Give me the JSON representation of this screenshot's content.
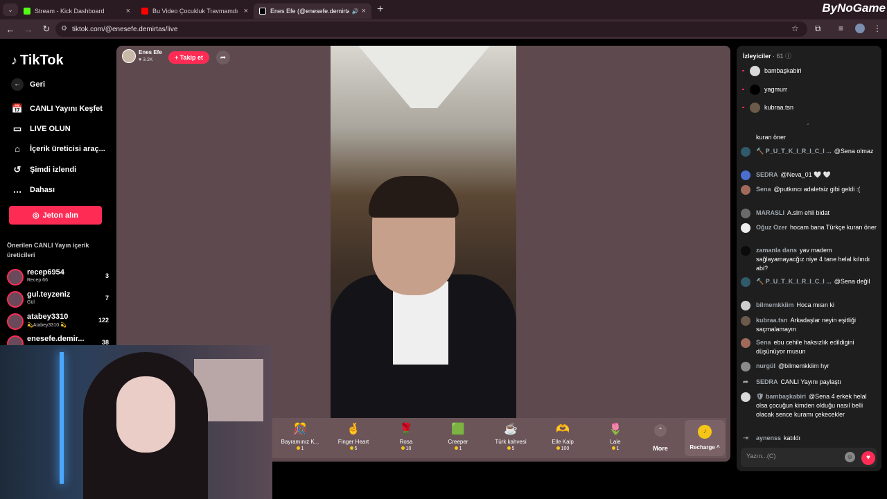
{
  "browser": {
    "tabs": [
      {
        "title": "Stream - Kick Dashboard",
        "color": "#53fc18",
        "active": false
      },
      {
        "title": "Bu Video Çocukluk Travmamdı",
        "color": "#ff0000",
        "active": false
      },
      {
        "title": "Enes Efe (@enesefe.demirta",
        "color": "#ffffff",
        "active": true
      }
    ],
    "url": "tiktok.com/@enesefe.demirtas/live",
    "brand": "ByNoGame"
  },
  "sidebar": {
    "logo": "TikTok",
    "back": "Geri",
    "nav": [
      {
        "label": "CANLI Yayını Keşfet",
        "icon": "live-explore-icon"
      },
      {
        "label": "LIVE OLUN",
        "icon": "video-camera-icon"
      },
      {
        "label": "İçerik üreticisi araç...",
        "icon": "creator-tools-icon"
      },
      {
        "label": "Şimdi izlendi",
        "icon": "history-icon"
      },
      {
        "label": "Dahası",
        "icon": "more-icon"
      }
    ],
    "coin_button": "Jeton alın",
    "recommended_title": "Önerilen CANLI Yayın içerik üreticileri",
    "creators": [
      {
        "name": "recep6954",
        "sub": "Recep 66",
        "count": "3"
      },
      {
        "name": "gul.teyzeniz",
        "sub": "Gül",
        "count": "7"
      },
      {
        "name": "atabey3310",
        "sub": "💫Atabey3310 💫",
        "count": "122"
      },
      {
        "name": "enesefe.demir...",
        "sub": "",
        "count": "38"
      }
    ]
  },
  "stream": {
    "host_name": "Enes Efe",
    "host_likes": "♥ 3.2K",
    "follow": "+ Takip et"
  },
  "gifts": [
    {
      "name": "Bayramınız K...",
      "price": "1",
      "icon": "🎊"
    },
    {
      "name": "Finger Heart",
      "price": "5",
      "icon": "🤞"
    },
    {
      "name": "Rosa",
      "price": "10",
      "icon": "🌹"
    },
    {
      "name": "Creeper",
      "price": "1",
      "icon": "🟩"
    },
    {
      "name": "Türk kahvesi",
      "price": "5",
      "icon": "☕"
    },
    {
      "name": "Elle Kalp",
      "price": "100",
      "icon": "🫶"
    },
    {
      "name": "Lale",
      "price": "1",
      "icon": "🌷"
    }
  ],
  "gift_more": "More",
  "recharge": "Recharge ^",
  "chat": {
    "viewers_label": "İzleyiciler",
    "viewers_count": "· 61",
    "viewers": [
      {
        "name": "bambaşkabiri",
        "color": "#d9d9d9"
      },
      {
        "name": "yagmurr",
        "color": "#000000"
      },
      {
        "name": "kubraa.tsn",
        "color": "#6b5a4a"
      }
    ],
    "messages": [
      {
        "user": "",
        "text": "kuran öner"
      },
      {
        "user": "🔨 P_U_T_K_I_R_I_C_I ...",
        "text": "@Sena olmaz"
      },
      {
        "user": "SEDRA",
        "text": "@Neva_01 🤍 🤍"
      },
      {
        "user": "Sena",
        "text": "@putkıncı adaletsiz gibi geldi :("
      },
      {
        "user": "MARASLI",
        "text": "A.slm ehli bidat"
      },
      {
        "user": "Oğuz Ozer",
        "text": "hocam bana Türkçe kuran öner"
      },
      {
        "user": "zamanla dans",
        "text": "yav madem sağlayamayacğız niye 4 tane helal kılındı abi?"
      },
      {
        "user": "🔨 P_U_T_K_I_R_I_C_I ...",
        "text": "@Sena değil"
      },
      {
        "user": "bilmemkkiim",
        "text": "Hoca mısın ki"
      },
      {
        "user": "kubraa.tsn",
        "text": "Arkadaşlar neyin eşitliği saçmalamayın"
      },
      {
        "user": "Sena",
        "text": "ebu cehile haksızlık edildigini düşünüyor musun"
      },
      {
        "user": "nurgül",
        "text": "@bilmemkkiim hyr"
      },
      {
        "user": "SEDRA",
        "text": "CANLI Yayını paylaştı"
      },
      {
        "user": "🛡 bambaşkabiri",
        "text": "@Sena 4 erkek helal olsa çocuğun kimden olduğu nasıl belli olacak sence kuramı çekecekler"
      },
      {
        "user": "aynenss",
        "text": "katıldı"
      }
    ],
    "input_placeholder": "Yazın...(C)"
  }
}
